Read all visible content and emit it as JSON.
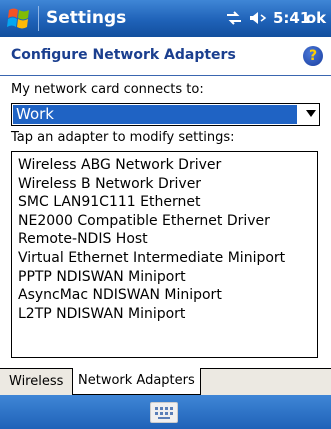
{
  "titlebar": {
    "title": "Settings",
    "time": "5:41",
    "ok_label": "ok"
  },
  "header": {
    "title": "Configure Network Adapters"
  },
  "connects": {
    "label": "My network card connects to:",
    "selected": "Work"
  },
  "adapters": {
    "label": "Tap an adapter to modify settings:",
    "items": [
      "Wireless ABG Network Driver",
      "Wireless B Network Driver",
      "SMC LAN91C111 Ethernet",
      "NE2000 Compatible Ethernet Driver",
      "Remote-NDIS Host",
      "Virtual Ethernet Intermediate Miniport",
      "PPTP NDISWAN Miniport",
      "AsyncMac NDISWAN Miniport",
      "L2TP NDISWAN Miniport"
    ]
  },
  "tabs": [
    {
      "label": "Wireless"
    },
    {
      "label": "Network Adapters"
    }
  ],
  "colors": {
    "titlebar": "#1f62b8",
    "header_text": "#1b3f8f",
    "selection": "#1f63c4"
  }
}
